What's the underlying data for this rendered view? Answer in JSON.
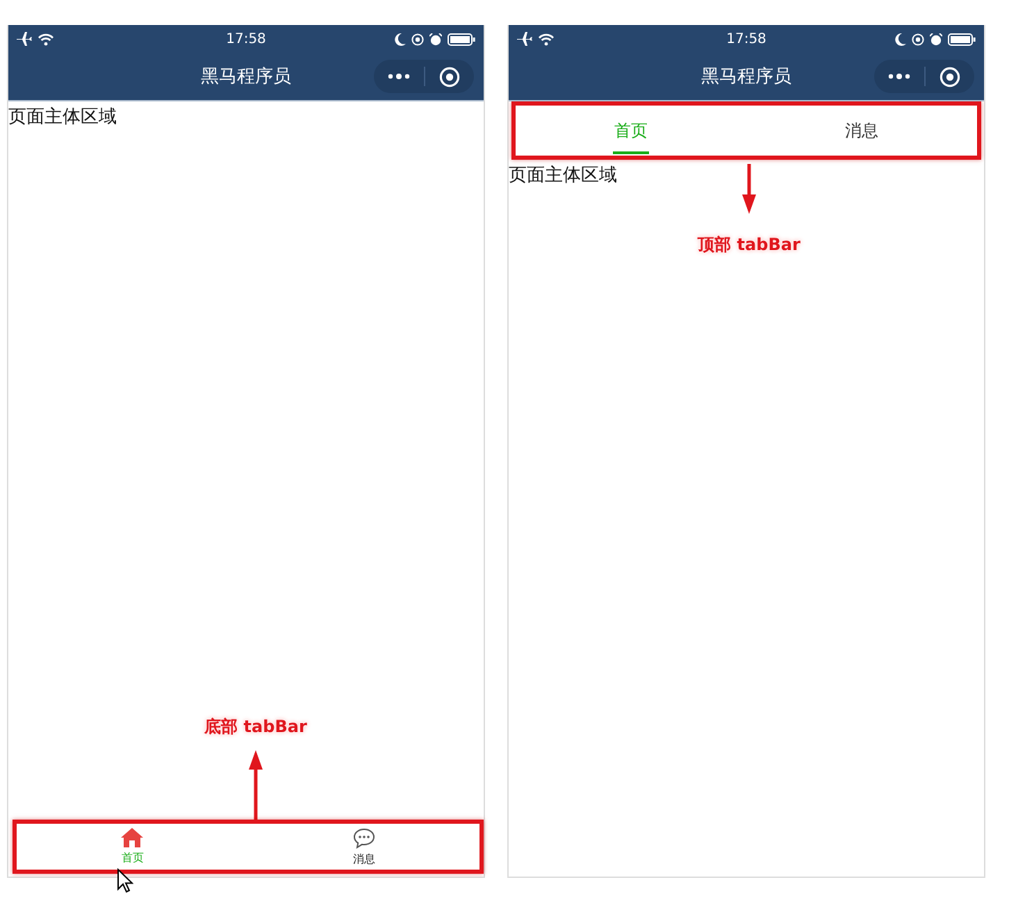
{
  "screens": [
    {
      "status_bar": {
        "time": "17:58"
      },
      "nav_bar": {
        "title": "黑马程序员"
      },
      "body_text": "页面主体区域",
      "tab_bar": {
        "kind": "bottom",
        "tabs": [
          {
            "label": "首页",
            "selected": true
          },
          {
            "label": "消息",
            "selected": false
          }
        ]
      },
      "annotation": {
        "label": "底部 tabBar"
      }
    },
    {
      "status_bar": {
        "time": "17:58"
      },
      "nav_bar": {
        "title": "黑马程序员"
      },
      "body_text": "页面主体区域",
      "tab_bar": {
        "kind": "top",
        "tabs": [
          {
            "label": "首页",
            "selected": true
          },
          {
            "label": "消息",
            "selected": false
          }
        ]
      },
      "annotation": {
        "label": "顶部 tabBar"
      }
    }
  ]
}
